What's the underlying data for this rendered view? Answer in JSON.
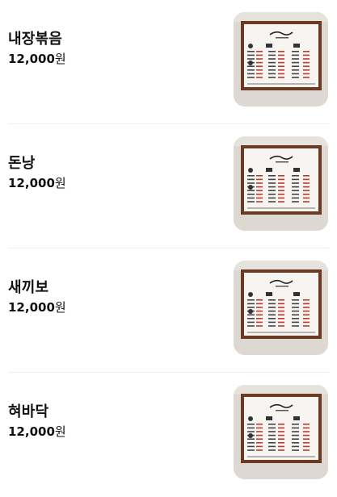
{
  "menu": {
    "items": [
      {
        "name": "내장볶음",
        "price": "12,000",
        "currency": "원",
        "image_icon": "menu-board-photo"
      },
      {
        "name": "돈낭",
        "price": "12,000",
        "currency": "원",
        "image_icon": "menu-board-photo"
      },
      {
        "name": "새끼보",
        "price": "12,000",
        "currency": "원",
        "image_icon": "menu-board-photo"
      },
      {
        "name": "혀바닥",
        "price": "12,000",
        "currency": "원",
        "image_icon": "menu-board-photo"
      }
    ]
  },
  "colors": {
    "wall": "#ddd8d2",
    "frame": "#6b3a22",
    "board": "#f7f5f1",
    "price_red": "#c0392b",
    "divider": "#eeeeee"
  }
}
